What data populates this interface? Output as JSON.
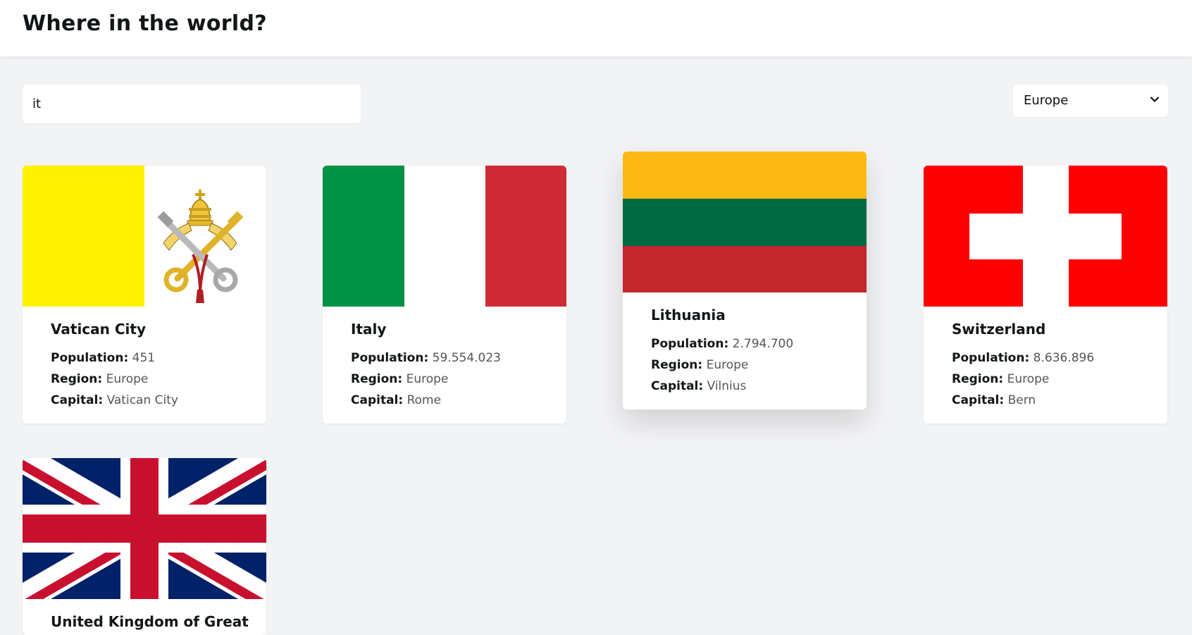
{
  "header": {
    "title": "Where in the world?"
  },
  "search": {
    "value": "it",
    "placeholder": ""
  },
  "filter": {
    "selected": "Europe"
  },
  "labels": {
    "population": "Population:",
    "region": "Region:",
    "capital": "Capital:"
  },
  "countries": [
    {
      "name": "Vatican City",
      "population": "451",
      "region": "Europe",
      "capital": "Vatican City",
      "flag": "vatican-flag"
    },
    {
      "name": "Italy",
      "population": "59.554.023",
      "region": "Europe",
      "capital": "Rome",
      "flag": "italy-flag"
    },
    {
      "name": "Lithuania",
      "population": "2.794.700",
      "region": "Europe",
      "capital": "Vilnius",
      "flag": "lithuania-flag"
    },
    {
      "name": "Switzerland",
      "population": "8.636.896",
      "region": "Europe",
      "capital": "Bern",
      "flag": "switzerland-flag"
    },
    {
      "name": "United Kingdom of Great",
      "flag": "uk-flag"
    }
  ],
  "colors": {
    "background": "#f2f3f5",
    "vatican_yellow": "#fff100",
    "italy_green": "#009246",
    "italy_red": "#ce2b37",
    "lithuania_yellow": "#fdb913",
    "lithuania_green": "#006a44",
    "lithuania_red": "#c1272d",
    "swiss_red": "#ff0000",
    "uk_blue": "#012169",
    "uk_red": "#c8102e"
  }
}
